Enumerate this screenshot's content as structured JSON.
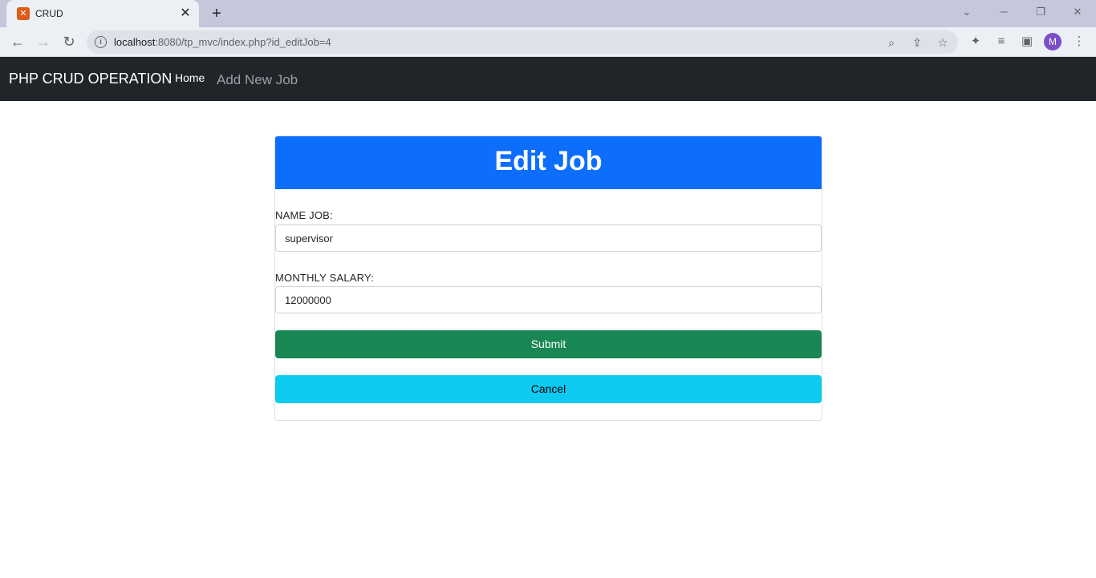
{
  "browser": {
    "tab_title": "CRUD",
    "tab_favicon": "xampp-icon",
    "url_host": "localhost",
    "url_rest": ":8080/tp_mvc/index.php?id_editJob=4",
    "avatar_letter": "M"
  },
  "navbar": {
    "brand": "PHP CRUD OPERATION",
    "links": [
      "Home",
      "Add New Job"
    ]
  },
  "form": {
    "title": "Edit Job",
    "name_label": "NAME JOB:",
    "name_value": "supervisor",
    "salary_label": "MONTHLY SALARY:",
    "salary_value": "12000000",
    "submit_label": "Submit",
    "cancel_label": "Cancel"
  },
  "colors": {
    "header": "#0d6efd",
    "submit": "#198754",
    "cancel": "#0dcaf0",
    "navbar": "#212529"
  }
}
